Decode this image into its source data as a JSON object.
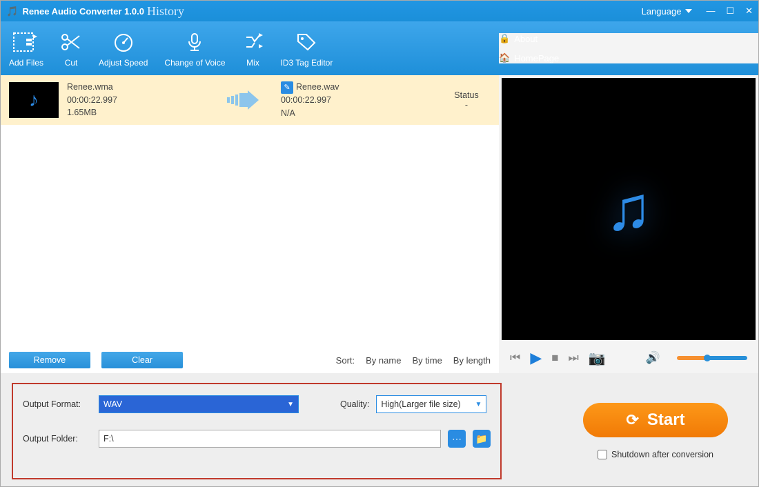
{
  "title": {
    "app": "Renee Audio Converter 1.0.0",
    "history": "History",
    "language": "Language"
  },
  "winbtns": {
    "min": "—",
    "max": "☐",
    "close": "✕"
  },
  "toolbar": {
    "add_files": "Add Files",
    "cut": "Cut",
    "adjust_speed": "Adjust Speed",
    "change_voice": "Change of Voice",
    "mix": "Mix",
    "id3": "ID3 Tag Editor",
    "about": "About",
    "homepage": "HomePage"
  },
  "file": {
    "src_name": "Renee.wma",
    "src_time": "00:00:22.997",
    "src_size": "1.65MB",
    "dst_name": "Renee.wav",
    "dst_time": "00:00:22.997",
    "dst_size": "N/A",
    "status_label": "Status",
    "status_value": "-"
  },
  "controls": {
    "remove": "Remove",
    "clear": "Clear",
    "sort": "Sort:",
    "by_name": "By name",
    "by_time": "By time",
    "by_length": "By length"
  },
  "output": {
    "format_label": "Output Format:",
    "format_value": "WAV",
    "quality_label": "Quality:",
    "quality_value": "High(Larger file size)",
    "folder_label": "Output Folder:",
    "folder_value": "F:\\"
  },
  "action": {
    "start": "Start",
    "shutdown": "Shutdown after conversion"
  }
}
